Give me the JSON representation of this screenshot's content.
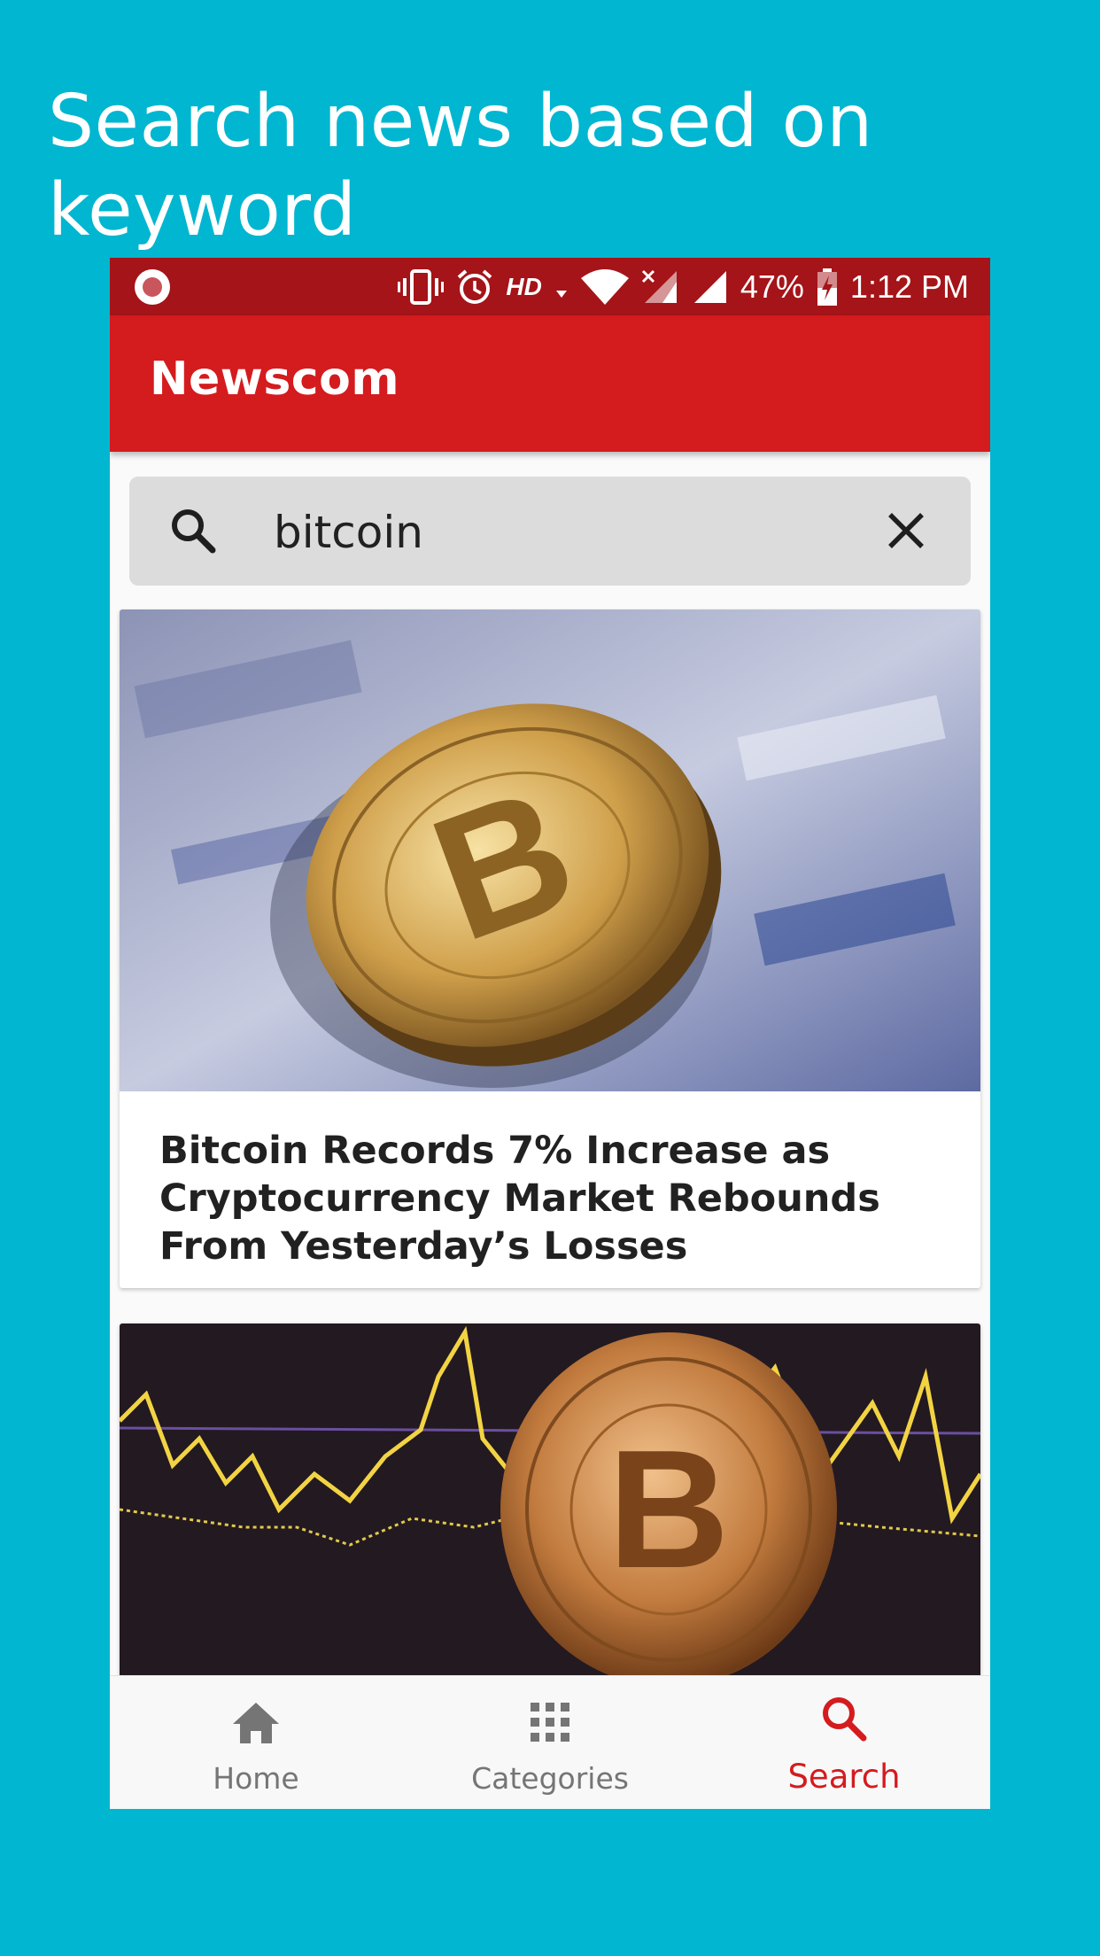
{
  "promo": {
    "title": "Search news based on keyword"
  },
  "status_bar": {
    "network": "HD",
    "battery": "47%",
    "time": "1:12 PM"
  },
  "app_bar": {
    "title": "Newscom"
  },
  "search": {
    "value": "bitcoin"
  },
  "results": [
    {
      "headline": "Bitcoin Records 7% Increase as Cryptocurrency Market Rebounds From Yesterday’s Losses",
      "image": "bitcoin-coin-photo"
    },
    {
      "headline": "",
      "image": "bitcoin-chart-photo"
    }
  ],
  "bottom_nav": {
    "items": [
      {
        "label": "Home",
        "icon": "home-icon",
        "active": false
      },
      {
        "label": "Categories",
        "icon": "grid-icon",
        "active": false
      },
      {
        "label": "Search",
        "icon": "search-icon",
        "active": true
      }
    ]
  },
  "colors": {
    "background": "#00b6d0",
    "app_bar": "#d41b1e",
    "status_bar": "#a41418",
    "accent": "#d41b1e"
  }
}
